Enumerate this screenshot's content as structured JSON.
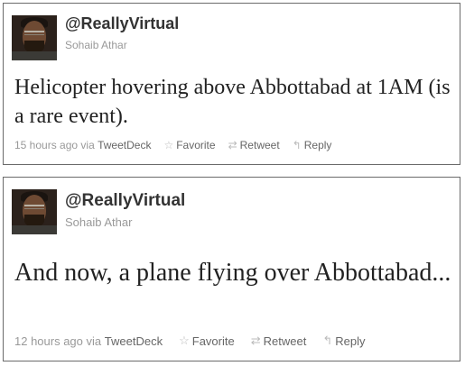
{
  "tweets": [
    {
      "handle": "@ReallyVirtual",
      "name": "Sohaib Athar",
      "text": "Helicopter hovering above Abbottabad at 1AM (is a rare event).",
      "time": "15 hours ago",
      "via": "via",
      "client": "TweetDeck",
      "favorite_label": "Favorite",
      "retweet_label": "Retweet",
      "reply_label": "Reply"
    },
    {
      "handle": "@ReallyVirtual",
      "name": "Sohaib Athar",
      "text": "And now, a plane flying over Abbottabad...",
      "time": "12 hours ago",
      "via": "via",
      "client": "TweetDeck",
      "favorite_label": "Favorite",
      "retweet_label": "Retweet",
      "reply_label": "Reply"
    }
  ],
  "icons": {
    "favorite": "star-outline-icon",
    "retweet": "retweet-icon",
    "reply": "reply-arrow-icon"
  },
  "colors": {
    "handle": "#333333",
    "meta": "#999999",
    "action": "#666666",
    "border": "#6b6b6b"
  }
}
